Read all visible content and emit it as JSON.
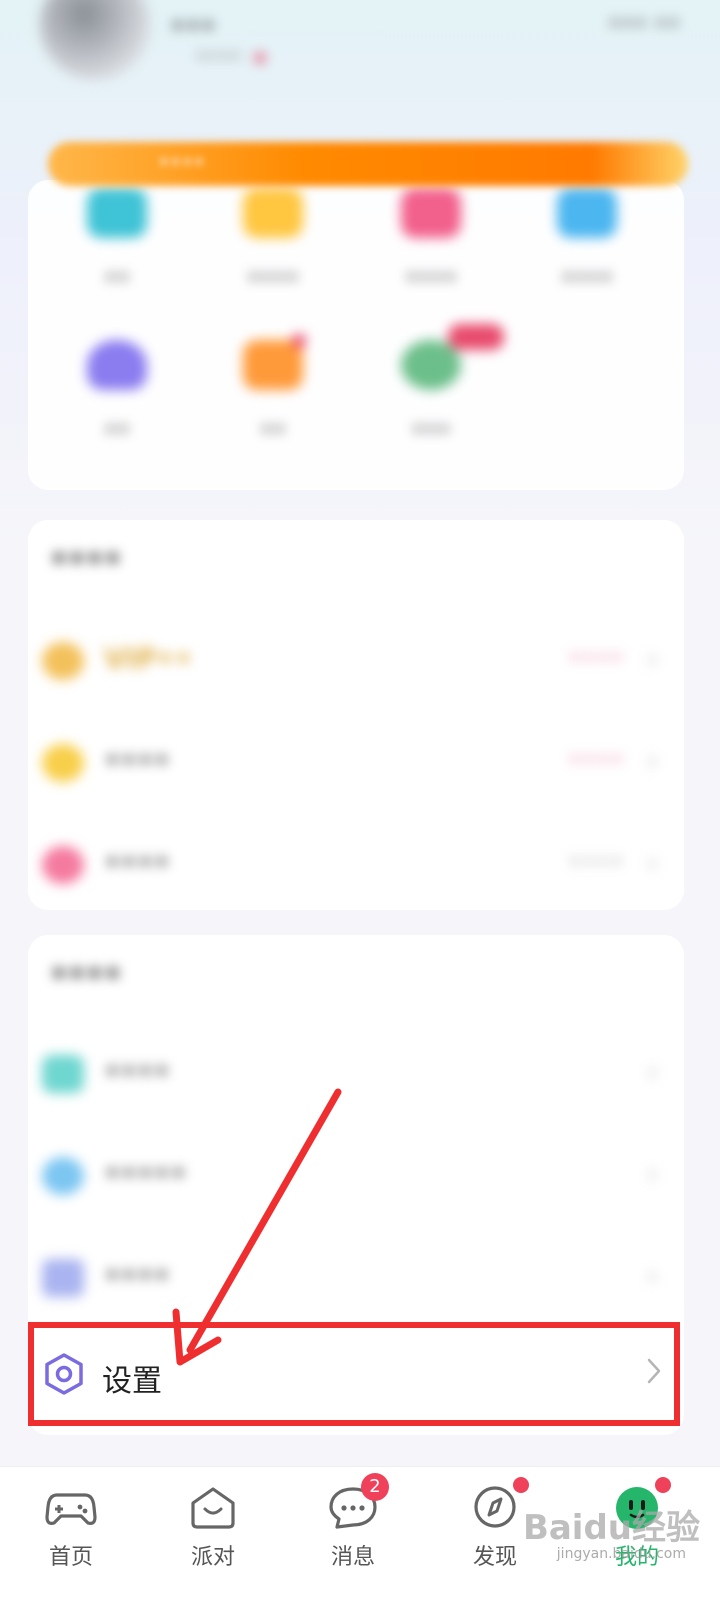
{
  "header": {
    "username": "•••",
    "sub_info": "••••",
    "top_right": "••• ••"
  },
  "banner": {
    "text": "••••"
  },
  "shortcuts": [
    {
      "label": "••",
      "color": "#3fc3d6"
    },
    {
      "label": "••••",
      "color": "#ffc640"
    },
    {
      "label": "••••",
      "color": "#f2608c"
    },
    {
      "label": "••••",
      "color": "#4cb6f0"
    },
    {
      "label": "••",
      "color": "#8b7cf0"
    },
    {
      "label": "••",
      "color": "#ff9a3a"
    },
    {
      "label": "•••",
      "color": "#6cbf8a"
    }
  ],
  "hot_services": {
    "title": "••••",
    "rows": [
      {
        "label": "VIP••",
        "value": "••••",
        "icon_color": "#f3c15b",
        "label_color": "#e0b04a",
        "value_color": "#f0a0b8"
      },
      {
        "label": "••••",
        "value": "••••",
        "icon_color": "#f8cf4a",
        "label_color": "#444",
        "value_color": "#f0a0b8"
      },
      {
        "label": "••••",
        "value": "••••",
        "icon_color": "#f57aa0",
        "label_color": "#444",
        "value_color": "#bbb"
      }
    ]
  },
  "more_features": {
    "title": "••••",
    "rows": [
      {
        "label": "••••",
        "icon_color": "#6fd6d0"
      },
      {
        "label": "•••••",
        "icon_color": "#7cc6f2"
      },
      {
        "label": "••••",
        "icon_color": "#aab4f0"
      }
    ]
  },
  "settings": {
    "label": "设置",
    "icon_color": "#7b6be0"
  },
  "highlight_color": "#ef2f2f",
  "bottom_nav": [
    {
      "label": "首页",
      "icon": "gamepad-icon",
      "active": false
    },
    {
      "label": "派对",
      "icon": "party-icon",
      "active": false
    },
    {
      "label": "消息",
      "icon": "message-icon",
      "badge": "2",
      "active": false
    },
    {
      "label": "发现",
      "icon": "compass-icon",
      "active": false
    },
    {
      "label": "我的",
      "icon": "profile-face-icon",
      "active": true
    }
  ],
  "watermark": {
    "text": "Baidu经验",
    "sub": "jingyan.baidu.com"
  }
}
